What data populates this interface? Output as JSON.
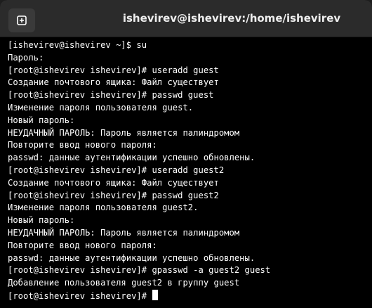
{
  "window": {
    "title": "ishevirev@ishevirev:/home/ishevirev"
  },
  "icons": {
    "new_tab": "new-tab-icon"
  },
  "colors": {
    "terminal_background": "#000000",
    "terminal_text": "#ffffff",
    "titlebar_background": "#2b2b2b"
  },
  "terminal": {
    "lines": [
      "[ishevirev@ishevirev ~]$ su",
      "Пароль:",
      "[root@ishevirev ishevirev]# useradd guest",
      "Создание почтового ящика: Файл существует",
      "[root@ishevirev ishevirev]# passwd guest",
      "Изменение пароля пользователя guest.",
      "Новый пароль:",
      "НЕУДАЧНЫЙ ПАРОЛЬ: Пароль является палиндромом",
      "Повторите ввод нового пароля:",
      "passwd: данные аутентификации успешно обновлены.",
      "[root@ishevirev ishevirev]# useradd guest2",
      "Создание почтового ящика: Файл существует",
      "[root@ishevirev ishevirev]# passwd guest2",
      "Изменение пароля пользователя guest2.",
      "Новый пароль:",
      "НЕУДАЧНЫЙ ПАРОЛЬ: Пароль является палиндромом",
      "Повторите ввод нового пароля:",
      "passwd: данные аутентификации успешно обновлены.",
      "[root@ishevirev ishevirev]# gpasswd -a guest2 guest",
      "Добавление пользователя guest2 в группу guest"
    ],
    "prompt": "[root@ishevirev ishevirev]# "
  }
}
